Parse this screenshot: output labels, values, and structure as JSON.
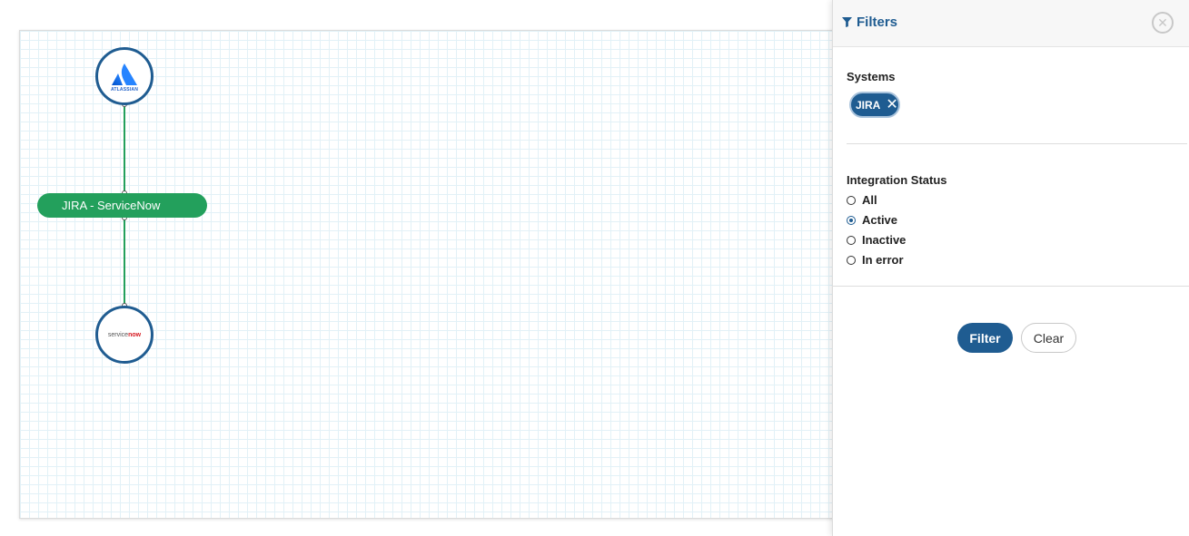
{
  "canvas": {
    "nodes": [
      {
        "id": "atlassian",
        "logo_label": "ATLASSIAN"
      },
      {
        "id": "servicenow",
        "logo_label_service": "service",
        "logo_label_now": "now"
      }
    ],
    "integration_label": "JIRA - ServiceNow",
    "colors": {
      "node_border": "#1f5c91",
      "integration": "#23a05c",
      "edge": "#23a05c"
    }
  },
  "panel": {
    "title": "Filters",
    "close_icon": "close-circle-icon",
    "systems": {
      "label": "Systems",
      "chips": [
        {
          "label": "JIRA"
        }
      ]
    },
    "integration_status": {
      "label": "Integration Status",
      "options": [
        {
          "label": "All",
          "checked": false
        },
        {
          "label": "Active",
          "checked": true
        },
        {
          "label": "Inactive",
          "checked": false
        },
        {
          "label": "In error",
          "checked": false
        }
      ]
    },
    "buttons": {
      "filter": "Filter",
      "clear": "Clear"
    },
    "colors": {
      "accent": "#1f5c91"
    }
  }
}
